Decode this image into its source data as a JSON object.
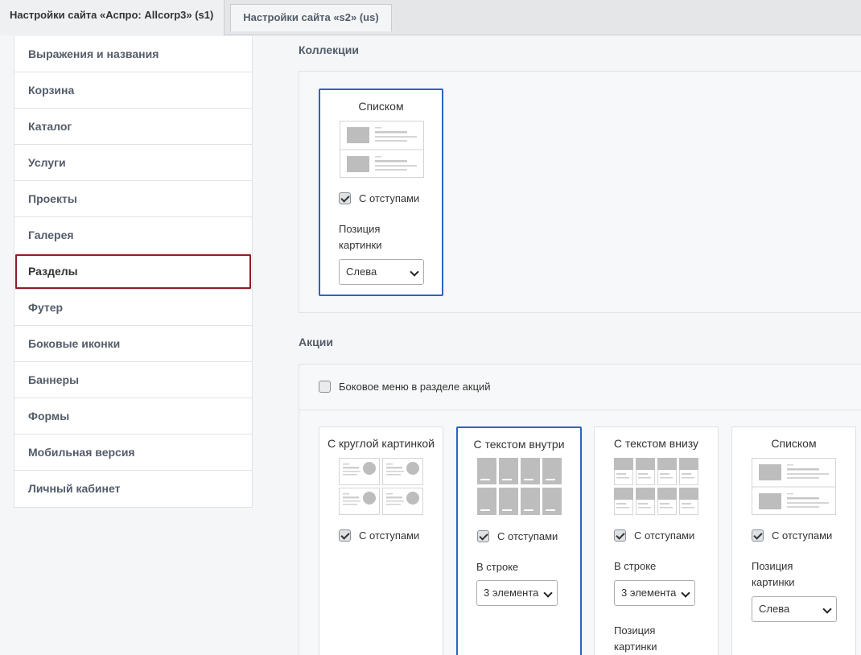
{
  "tabs": [
    {
      "label": "Настройки сайта «Аспро: Allcorp3» (s1)"
    },
    {
      "label": "Настройки сайта «s2» (us)"
    }
  ],
  "sidebar": {
    "items": [
      {
        "label": "Выражения и названия"
      },
      {
        "label": "Корзина"
      },
      {
        "label": "Каталог"
      },
      {
        "label": "Услуги"
      },
      {
        "label": "Проекты"
      },
      {
        "label": "Галерея"
      },
      {
        "label": "Разделы",
        "active": true
      },
      {
        "label": "Футер"
      },
      {
        "label": "Боковые иконки"
      },
      {
        "label": "Баннеры"
      },
      {
        "label": "Формы"
      },
      {
        "label": "Мобильная версия"
      },
      {
        "label": "Личный кабинет"
      }
    ]
  },
  "collections": {
    "title": "Коллекции",
    "card": {
      "title": "Списком",
      "checkbox_label": "С отступами",
      "checked": true,
      "position_label": "Позиция картинки",
      "position_value": "Слева"
    }
  },
  "actions": {
    "title": "Акции",
    "side_menu_label": "Боковое меню в разделе акций",
    "side_menu_checked": false,
    "cards": [
      {
        "title": "С круглой картинкой",
        "checkbox_label": "С отступами",
        "checked": true
      },
      {
        "title": "С текстом внутри",
        "checkbox_label": "С отступами",
        "checked": true,
        "row_label": "В строке",
        "row_value": "3 элемента",
        "selected": true
      },
      {
        "title": "С текстом внизу",
        "checkbox_label": "С отступами",
        "checked": true,
        "row_label": "В строке",
        "row_value": "3 элемента",
        "position_label": "Позиция картинки"
      },
      {
        "title": "Списком",
        "checkbox_label": "С отступами",
        "checked": true,
        "position_label": "Позиция картинки",
        "position_value": "Слева"
      }
    ]
  },
  "colors": {
    "selected_border": "#2f62c6",
    "active_sidebar_border": "#8e1e24"
  }
}
